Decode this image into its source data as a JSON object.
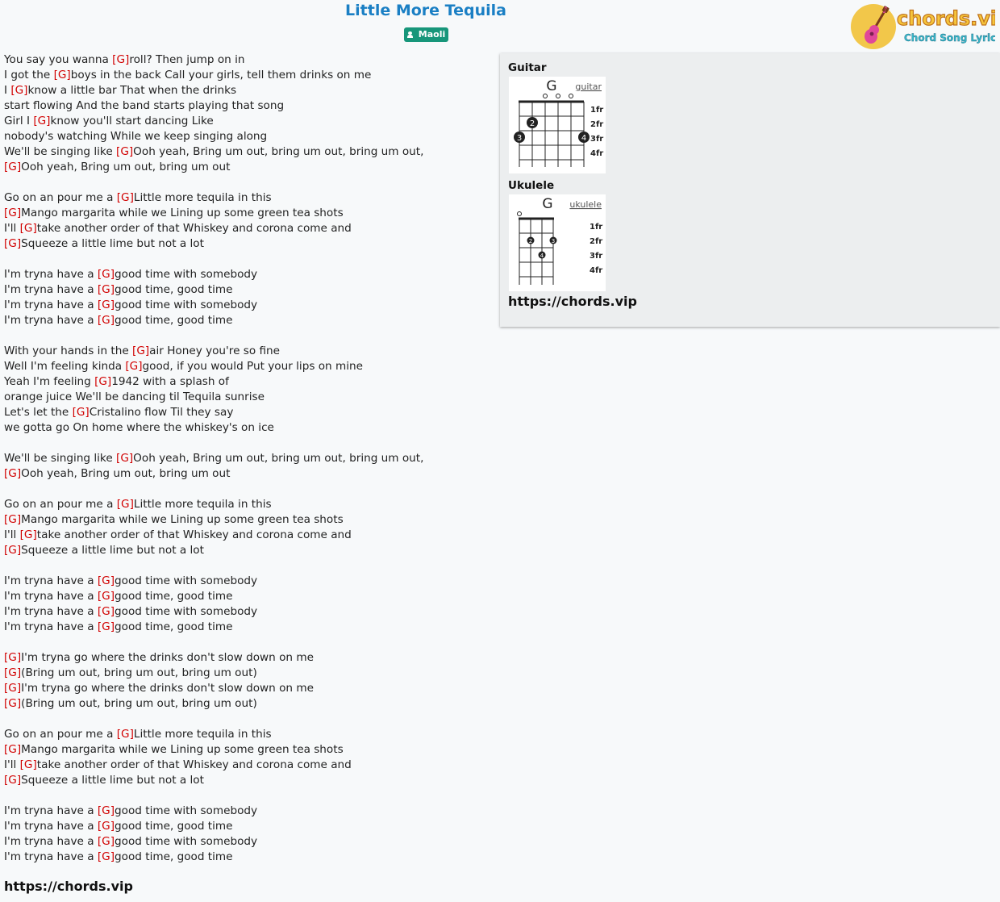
{
  "song": {
    "title": "Little More Tequila",
    "artist": "Maoli"
  },
  "logo": {
    "brand": "chords.vip",
    "tagline": "Chord Song Lyric"
  },
  "lyrics": [
    [
      {
        "t": "You say you wanna "
      },
      {
        "c": "[G]"
      },
      {
        "t": "roll? Then jump on in"
      }
    ],
    [
      {
        "t": "I got the "
      },
      {
        "c": "[G]"
      },
      {
        "t": "boys in the back Call your girls, tell them drinks on me"
      }
    ],
    [
      {
        "t": "I "
      },
      {
        "c": "[G]"
      },
      {
        "t": "know a little bar That when the drinks"
      }
    ],
    [
      {
        "t": "start flowing And the band starts playing that song"
      }
    ],
    [
      {
        "t": "Girl I "
      },
      {
        "c": "[G]"
      },
      {
        "t": "know you'll start dancing Like"
      }
    ],
    [
      {
        "t": "nobody's watching While we keep singing along"
      }
    ],
    [
      {
        "t": "We'll be singing like "
      },
      {
        "c": "[G]"
      },
      {
        "t": "Ooh yeah, Bring um out, bring um out, bring um out,"
      }
    ],
    [
      {
        "c": "[G]"
      },
      {
        "t": "Ooh yeah, Bring um out, bring um out"
      }
    ],
    [],
    [
      {
        "t": "Go on an pour me a "
      },
      {
        "c": "[G]"
      },
      {
        "t": "Little more tequila in this"
      }
    ],
    [
      {
        "c": "[G]"
      },
      {
        "t": "Mango margarita while we Lining up some green tea shots"
      }
    ],
    [
      {
        "t": "I'll "
      },
      {
        "c": "[G]"
      },
      {
        "t": "take another order of that Whiskey and corona come and"
      }
    ],
    [
      {
        "c": "[G]"
      },
      {
        "t": "Squeeze a little lime but not a lot"
      }
    ],
    [],
    [
      {
        "t": "I'm tryna have a "
      },
      {
        "c": "[G]"
      },
      {
        "t": "good time with somebody"
      }
    ],
    [
      {
        "t": "I'm tryna have a "
      },
      {
        "c": "[G]"
      },
      {
        "t": "good time, good time"
      }
    ],
    [
      {
        "t": "I'm tryna have a "
      },
      {
        "c": "[G]"
      },
      {
        "t": "good time with somebody"
      }
    ],
    [
      {
        "t": "I'm tryna have a "
      },
      {
        "c": "[G]"
      },
      {
        "t": "good time, good time"
      }
    ],
    [],
    [
      {
        "t": "With your hands in the "
      },
      {
        "c": "[G]"
      },
      {
        "t": "air Honey you're so fine"
      }
    ],
    [
      {
        "t": "Well I'm feeling kinda "
      },
      {
        "c": "[G]"
      },
      {
        "t": "good, if you would Put your lips on mine"
      }
    ],
    [
      {
        "t": "Yeah I'm feeling "
      },
      {
        "c": "[G]"
      },
      {
        "t": "1942 with a splash of"
      }
    ],
    [
      {
        "t": "orange juice We'll be dancing til Tequila sunrise"
      }
    ],
    [
      {
        "t": "Let's let the "
      },
      {
        "c": "[G]"
      },
      {
        "t": "Cristalino flow Til they say"
      }
    ],
    [
      {
        "t": "we gotta go On home where the whiskey's on ice"
      }
    ],
    [],
    [
      {
        "t": "We'll be singing like "
      },
      {
        "c": "[G]"
      },
      {
        "t": "Ooh yeah, Bring um out, bring um out, bring um out,"
      }
    ],
    [
      {
        "c": "[G]"
      },
      {
        "t": "Ooh yeah, Bring um out, bring um out"
      }
    ],
    [],
    [
      {
        "t": "Go on an pour me a "
      },
      {
        "c": "[G]"
      },
      {
        "t": "Little more tequila in this"
      }
    ],
    [
      {
        "c": "[G]"
      },
      {
        "t": "Mango margarita while we Lining up some green tea shots"
      }
    ],
    [
      {
        "t": "I'll "
      },
      {
        "c": "[G]"
      },
      {
        "t": "take another order of that Whiskey and corona come and"
      }
    ],
    [
      {
        "c": "[G]"
      },
      {
        "t": "Squeeze a little lime but not a lot"
      }
    ],
    [],
    [
      {
        "t": "I'm tryna have a "
      },
      {
        "c": "[G]"
      },
      {
        "t": "good time with somebody"
      }
    ],
    [
      {
        "t": "I'm tryna have a "
      },
      {
        "c": "[G]"
      },
      {
        "t": "good time, good time"
      }
    ],
    [
      {
        "t": "I'm tryna have a "
      },
      {
        "c": "[G]"
      },
      {
        "t": "good time with somebody"
      }
    ],
    [
      {
        "t": "I'm tryna have a "
      },
      {
        "c": "[G]"
      },
      {
        "t": "good time, good time"
      }
    ],
    [],
    [
      {
        "c": "[G]"
      },
      {
        "t": "I'm tryna go where the drinks don't slow down on me"
      }
    ],
    [
      {
        "c": "[G]"
      },
      {
        "t": "(Bring um out, bring um out, bring um out)"
      }
    ],
    [
      {
        "c": "[G]"
      },
      {
        "t": "I'm tryna go where the drinks don't slow down on me"
      }
    ],
    [
      {
        "c": "[G]"
      },
      {
        "t": "(Bring um out, bring um out, bring um out)"
      }
    ],
    [],
    [
      {
        "t": "Go on an pour me a "
      },
      {
        "c": "[G]"
      },
      {
        "t": "Little more tequila in this"
      }
    ],
    [
      {
        "c": "[G]"
      },
      {
        "t": "Mango margarita while we Lining up some green tea shots"
      }
    ],
    [
      {
        "t": "I'll "
      },
      {
        "c": "[G]"
      },
      {
        "t": "take another order of that Whiskey and corona come and"
      }
    ],
    [
      {
        "c": "[G]"
      },
      {
        "t": "Squeeze a little lime but not a lot"
      }
    ],
    [],
    [
      {
        "t": "I'm tryna have a "
      },
      {
        "c": "[G]"
      },
      {
        "t": "good time with somebody"
      }
    ],
    [
      {
        "t": "I'm tryna have a "
      },
      {
        "c": "[G]"
      },
      {
        "t": "good time, good time"
      }
    ],
    [
      {
        "t": "I'm tryna have a "
      },
      {
        "c": "[G]"
      },
      {
        "t": "good time with somebody"
      }
    ],
    [
      {
        "t": "I'm tryna have a "
      },
      {
        "c": "[G]"
      },
      {
        "t": "good time, good time"
      }
    ]
  ],
  "footer_url": "https://chords.vip",
  "panel": {
    "guitar": {
      "label": "Guitar",
      "chord": "G",
      "link": "guitar",
      "frets": [
        "1fr",
        "2fr",
        "3fr",
        "4fr"
      ],
      "fingers": [
        "2",
        "3",
        "4"
      ]
    },
    "ukulele": {
      "label": "Ukulele",
      "chord": "G",
      "link": "ukulele",
      "frets": [
        "1fr",
        "2fr",
        "3fr",
        "4fr"
      ],
      "fingers": [
        "2",
        "3",
        "4"
      ]
    },
    "url": "https://chords.vip"
  },
  "colors": {
    "title": "#1a7fc4",
    "chord": "#d10000",
    "badge": "#17967a"
  }
}
